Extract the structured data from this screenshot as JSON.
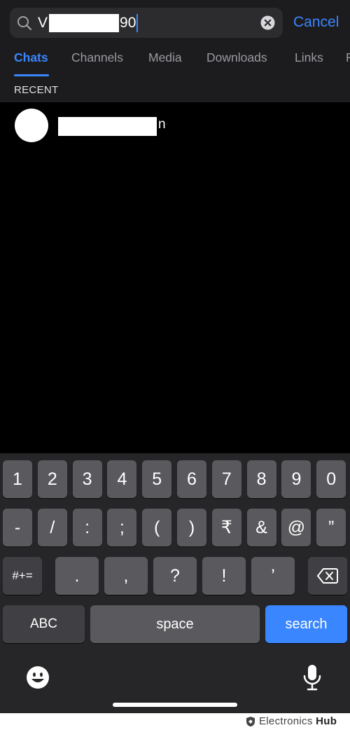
{
  "search": {
    "prefix": "V",
    "suffix": "90",
    "cancel_label": "Cancel"
  },
  "tabs": [
    {
      "label": "Chats",
      "active": true
    },
    {
      "label": "Channels",
      "active": false
    },
    {
      "label": "Media",
      "active": false
    },
    {
      "label": "Downloads",
      "active": false
    },
    {
      "label": "Links",
      "active": false
    },
    {
      "label": "F",
      "active": false
    }
  ],
  "section": {
    "label": "RECENT"
  },
  "results": [
    {
      "name_tail": "n"
    }
  ],
  "keyboard": {
    "row1": [
      "1",
      "2",
      "3",
      "4",
      "5",
      "6",
      "7",
      "8",
      "9",
      "0"
    ],
    "row2": [
      "-",
      "/",
      ":",
      ";",
      "(",
      ")",
      "₹",
      "&",
      "@",
      "”"
    ],
    "row3_toggle": "#+=",
    "row3": [
      ".",
      ",",
      "?",
      "!",
      "’"
    ],
    "abc_label": "ABC",
    "space_label": "space",
    "search_label": "search"
  },
  "watermark": {
    "brand": "Electronics",
    "brand_bold": "Hub"
  },
  "colors": {
    "accent": "#3a86ff",
    "background": "#000000",
    "key": "#5a5a5e",
    "key_dark": "#404044"
  }
}
